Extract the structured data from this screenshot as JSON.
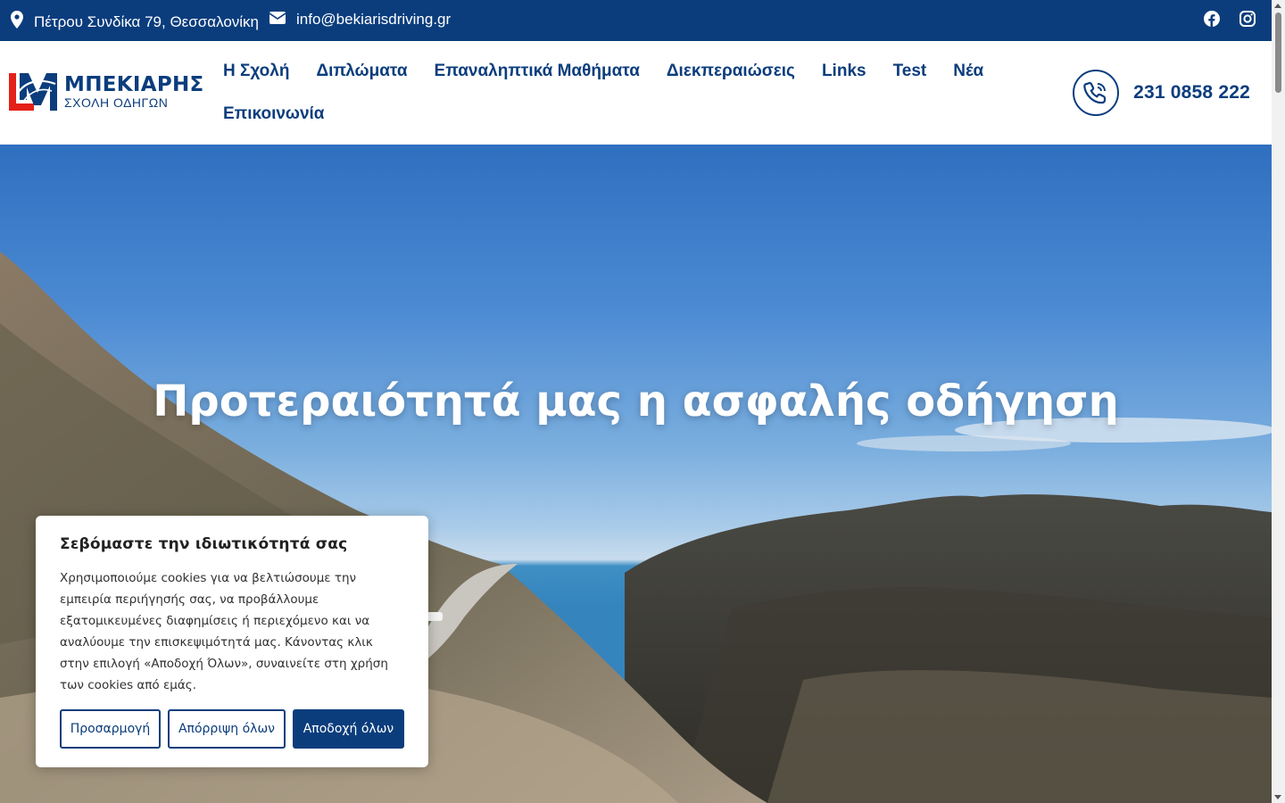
{
  "topbar": {
    "address": "Πέτρου Συνδίκα 79, Θεσσαλονίκη",
    "email": "info@bekiarisdriving.gr",
    "social": [
      "facebook-icon",
      "instagram-icon"
    ]
  },
  "brand": {
    "title": "ΜΠΕΚΙΑΡΗΣ",
    "subtitle": "ΣΧΟΛΗ ΟΔΗΓΩΝ"
  },
  "nav": {
    "items": [
      {
        "label": "Η Σχολή"
      },
      {
        "label": "Διπλώματα"
      },
      {
        "label": "Επαναληπτικά Μαθήματα"
      },
      {
        "label": "Διεκπεραιώσεις"
      },
      {
        "label": "Links"
      },
      {
        "label": "Test"
      },
      {
        "label": "Νέα"
      },
      {
        "label": "Επικοινωνία"
      }
    ]
  },
  "phone": {
    "number": "231 0858 222"
  },
  "hero": {
    "title": "Προτεραιότητά μας η ασφαλής οδήγηση"
  },
  "cookie": {
    "title": "Σεβόμαστε την ιδιωτικότητά σας",
    "text": "Χρησιμοποιούμε cookies για να βελτιώσουμε την εμπειρία περιήγησής σας, να προβάλλουμε εξατομικευμένες διαφημίσεις ή περιεχόμενο και να αναλύουμε την επισκεψιμότητά μας. Κάνοντας κλικ στην επιλογή «Αποδοχή Όλων», συναινείτε στη χρήση των cookies από εμάς.",
    "customize_label": "Προσαρμογή",
    "reject_label": "Απόρριψη όλων",
    "accept_label": "Αποδοχή όλων"
  },
  "colors": {
    "brand_blue": "#0b3d7d",
    "logo_red": "#e32119"
  }
}
